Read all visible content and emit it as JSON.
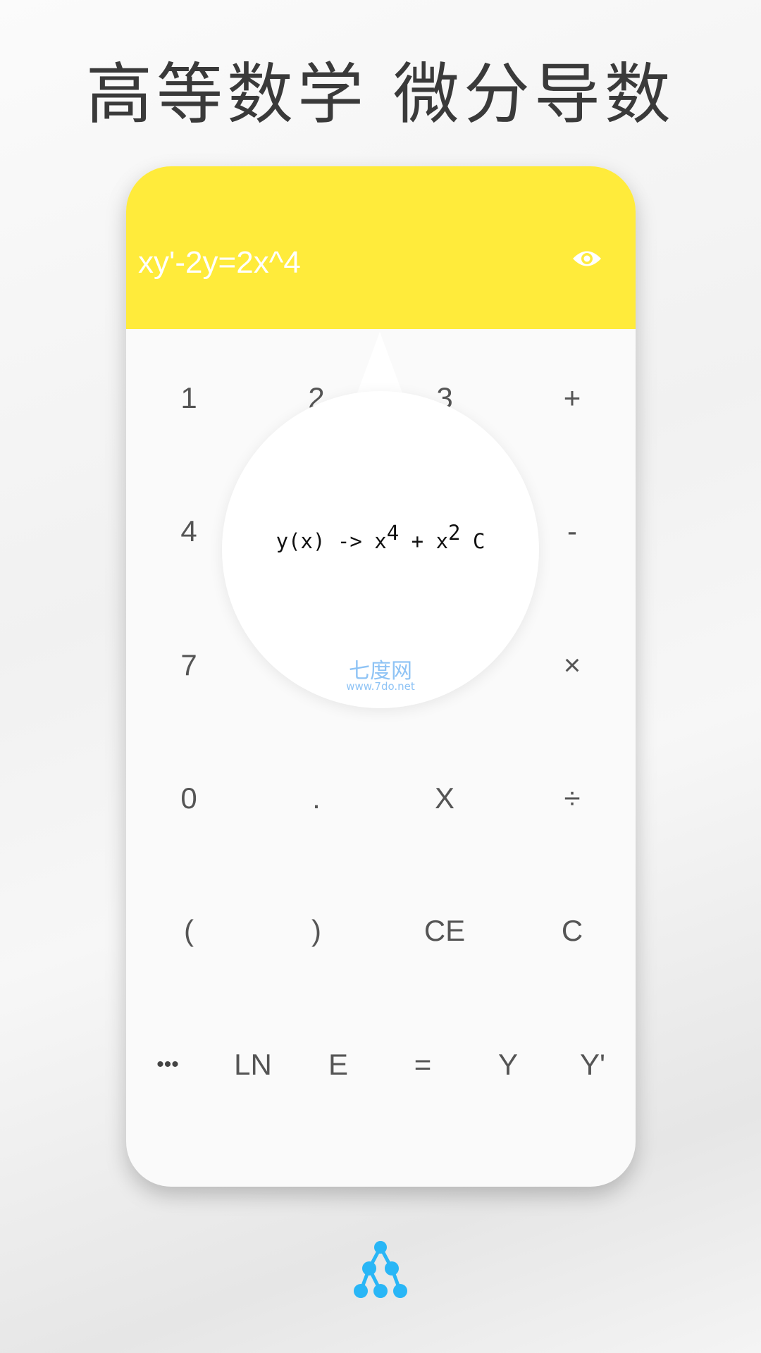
{
  "title": "高等数学 微分导数",
  "header": {
    "equation": "xy'-2y=2x^4",
    "eye_icon": "eye-icon",
    "background": "#ffeb3b"
  },
  "keys": {
    "row1": [
      "1",
      "2",
      "3",
      "+"
    ],
    "row2": [
      "4",
      "-"
    ],
    "row3": [
      "7",
      "×"
    ],
    "row4": [
      "0",
      ".",
      "X",
      "÷"
    ],
    "row5": [
      "(",
      ")",
      "CE",
      "C"
    ],
    "row6": [
      "•••",
      "LN",
      "E",
      "=",
      "Y",
      "Y'"
    ]
  },
  "result": {
    "prefix": "y(x) -> x",
    "exp1": "4",
    "middle": " + x",
    "exp2": "2",
    "suffix": " C"
  },
  "watermark": {
    "name": "七度网",
    "url": "www.7do.net"
  },
  "logo": {
    "icon": "tree-nodes-icon",
    "color": "#29b6f6"
  }
}
